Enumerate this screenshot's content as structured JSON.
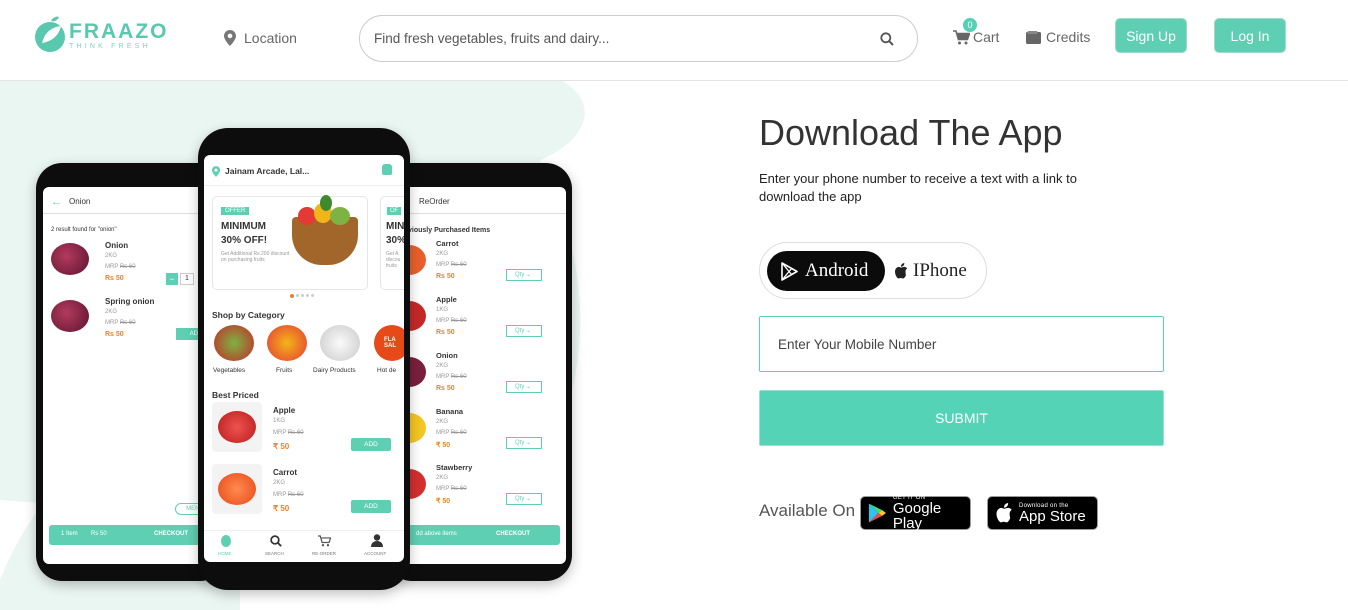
{
  "header": {
    "brand": "FRAAZO",
    "tagline": "THINK FRESH",
    "location_label": "Location",
    "search_placeholder": "Find fresh vegetables, fruits and dairy...",
    "cart_label": "Cart",
    "cart_count": "0",
    "credits_label": "Credits",
    "signup_label": "Sign Up",
    "login_label": "Log In"
  },
  "phones": {
    "left": {
      "search_text": "Onion",
      "results_text": "2 result found for \"onion\"",
      "items": [
        {
          "name": "Onion",
          "weight": "2KG",
          "mrp_label": "MRP",
          "mrp": "Rs 60",
          "price": "Rs 50",
          "qty": "1"
        },
        {
          "name": "Spring onion",
          "weight": "2KG",
          "mrp_label": "MRP",
          "mrp": "Rs 60",
          "price": "Rs 50",
          "action": "ADD"
        }
      ],
      "menu": "MENU",
      "bar_items": "1 Item",
      "bar_price": "Rs 50",
      "bar_checkout": "CHECKOUT"
    },
    "center": {
      "address": "Jainam Arcade, Lal...",
      "offer_badge": "OFFER",
      "offer_title_1": "MINIMUM",
      "offer_title_2": "30% OFF!",
      "offer_sub": "Get Additional Rs.200 discount on purchasing fruits",
      "offer2_badge": "OF",
      "offer2_title_1": "MINI",
      "offer2_title_2": "30%",
      "offer2_sub": "Get A discou fruits",
      "shop_heading": "Shop by Category",
      "categories": [
        "Vegetables",
        "Fruits",
        "Dairy Products",
        "Hot de"
      ],
      "flash_text": "FLA SAL",
      "best_heading": "Best Priced",
      "best_items": [
        {
          "name": "Apple",
          "weight": "1KG",
          "mrp_label": "MRP",
          "mrp": "Rs 60",
          "price": "₹ 50",
          "action": "ADD"
        },
        {
          "name": "Carrot",
          "weight": "2KG",
          "mrp_label": "MRP",
          "mrp": "Rs 60",
          "price": "₹ 50",
          "action": "ADD"
        }
      ],
      "nav": [
        "HOME",
        "SEARCH",
        "RE-ORDER",
        "ACCOUNT"
      ]
    },
    "right": {
      "title": "ReOrder",
      "section": "viously Purchased Items",
      "items": [
        {
          "name": "Carrot",
          "weight": "2KG",
          "mrp_label": "MRP",
          "mrp": "Rs 60",
          "price": "Rs 50",
          "qty": "Qty"
        },
        {
          "name": "Apple",
          "weight": "1KG",
          "mrp_label": "MRP",
          "mrp": "Rs 60",
          "price": "Rs 50",
          "qty": "Qty"
        },
        {
          "name": "Onion",
          "weight": "2KG",
          "mrp_label": "MRP",
          "mrp": "Rs 60",
          "price": "Rs 50",
          "qty": "Qty"
        },
        {
          "name": "Banana",
          "weight": "2KG",
          "mrp_label": "MRP",
          "mrp": "Rs 60",
          "price": "₹ 50",
          "qty": "Qty"
        },
        {
          "name": "Stawberry",
          "weight": "2KG",
          "mrp_label": "MRP",
          "mrp": "Rs 60",
          "price": "₹ 50",
          "qty": "Qty"
        }
      ],
      "bar_text": "dd above items",
      "bar_checkout": "CHECKOUT"
    }
  },
  "download": {
    "title": "Download The App",
    "description": "Enter your phone number to receive a text with a link to download the app",
    "android_label": "Android",
    "iphone_label": "IPhone",
    "mobile_placeholder": "Enter Your Mobile Number",
    "submit_label": "SUBMIT",
    "available_label": "Available On",
    "google_top": "GET IT ON",
    "google_main": "Google Play",
    "apple_top": "Download on the",
    "apple_main": "App Store"
  },
  "colors": {
    "accent": "#5fcfb3",
    "blob": "#e9f6f2",
    "price": "#f0802a"
  }
}
